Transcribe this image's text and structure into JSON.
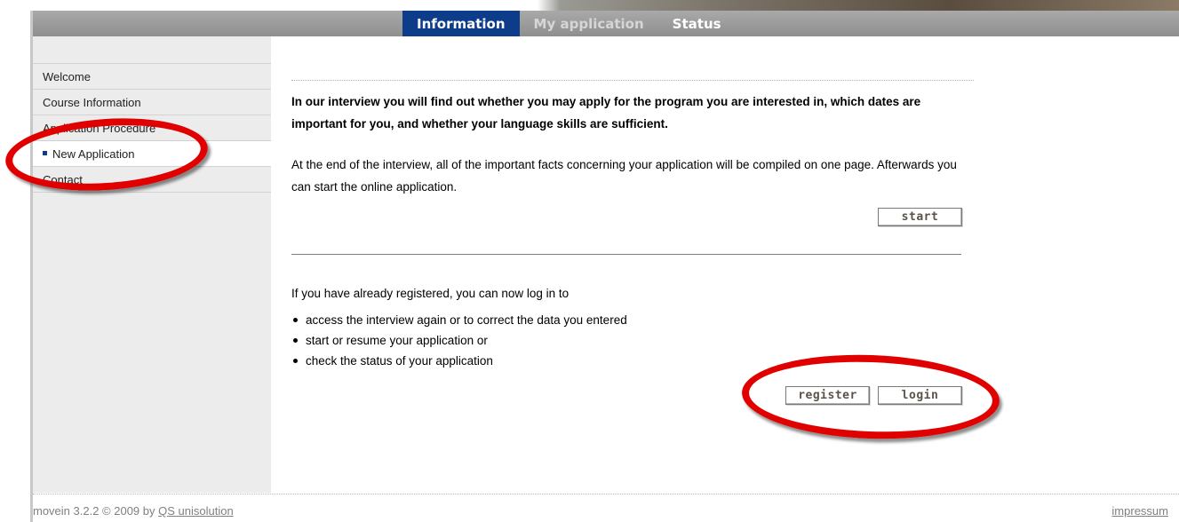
{
  "nav": {
    "tabs": [
      {
        "label": "Information",
        "active": true
      },
      {
        "label": "My application",
        "active": false
      },
      {
        "label": "Status",
        "active": false
      }
    ]
  },
  "sidebar": {
    "items": [
      {
        "label": "Welcome"
      },
      {
        "label": "Course Information"
      },
      {
        "label": "Application Procedure"
      },
      {
        "label": "New Application",
        "active": true
      },
      {
        "label": "Contact"
      }
    ]
  },
  "main": {
    "intro_bold": "In our interview you will find out whether you may apply for the program you are interested in, which dates are important for you, and whether your language skills are sufficient.",
    "intro_text": "At the end of the interview, all of the important facts concerning your application will be compiled on one page. Afterwards you can start the online application.",
    "start_label": "start",
    "login_intro": "If you have already registered, you can now log in to",
    "login_bullets": [
      "access the interview again or to correct the data you entered",
      "start or resume your application or",
      "check the status of your application"
    ],
    "register_label": "register",
    "login_label": "login"
  },
  "footer": {
    "version_text": "movein 3.2.2 © 2009 by",
    "company_link": "QS unisolution",
    "impressum": "impressum"
  },
  "colors": {
    "accent": "#0d3d8a",
    "highlight": "#e00000",
    "topbar": "#9a9a9a"
  }
}
